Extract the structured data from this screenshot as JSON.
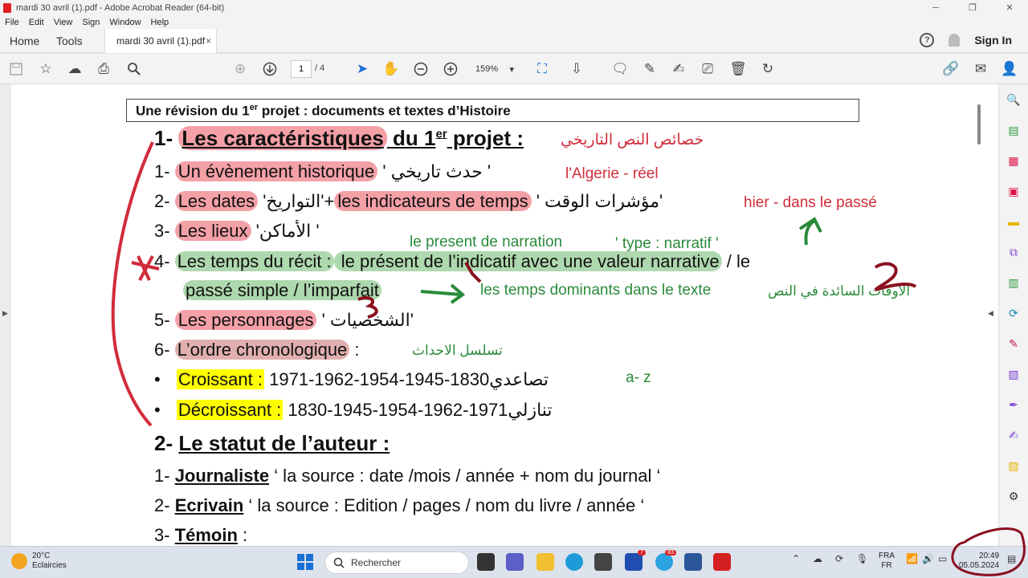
{
  "window": {
    "title": "mardi 30 avril (1).pdf - Adobe Acrobat Reader (64-bit)"
  },
  "menu": [
    "File",
    "Edit",
    "View",
    "Sign",
    "Window",
    "Help"
  ],
  "tabs": {
    "home": "Home",
    "tools": "Tools",
    "doc": "mardi 30 avril (1).pdf",
    "close": "×",
    "signin": "Sign In",
    "help": "?"
  },
  "toolbar": {
    "page_current": "1",
    "page_total": "/ 4",
    "zoom": "159%",
    "zoom_arrow": "▾"
  },
  "doc": {
    "title": "Une révision du 1",
    "title_sup": "er",
    "title_rest": " projet : documents et textes d’Histoire",
    "s1_num": "1-",
    "s1_hl": "Les caractéristiques",
    "s1_mid": " du 1",
    "s1_sup": "er",
    "s1_end": " projet :",
    "l1_num": "1-",
    "l1_hl": "Un évènement historique",
    "l1_rest": " ' حدث تاريخي '",
    "l2_num": "2-",
    "l2_hl": "Les dates",
    "l2_mid": "  'التواريخ'+",
    "l2_hl2": "les indicateurs de temps",
    "l2_rest": " ' مؤشرات الوقت'",
    "l3_num": "3-",
    "l3_hl": "Les lieux",
    "l3_rest": " 'الأماكن '",
    "l4_num": "4-",
    "l4_hl": "Les temps du récit :",
    "l4_hg": " le présent de l’indicatif avec une valeur narrative",
    "l4_rest": " / le",
    "l4b_hg": "passé simple / l’imparfait",
    "l5_num": "5-",
    "l5_hl": "Les personnages",
    "l5_rest": "  ' الشخصيات'",
    "l6_num": "6-",
    "l6_hd": "L’ordre chronologique",
    "l6_rest": " :",
    "b1_bullet": "•",
    "b1_hy": "Croissant :",
    "b1_rest": " تصاعدي1830-1945-1954-1962-1971",
    "b2_bullet": "•",
    "b2_hy": "Décroissant :",
    "b2_rest": " تنازلي1971-1962-1954-1945-1830",
    "s2_num": "2-",
    "s2_title": "Le statut de l’auteur :",
    "a1_num": "1-",
    "a1_label": "Journaliste",
    "a1_rest": " ‘ la source : date /mois / année + nom du journal ‘",
    "a2_num": "2-",
    "a2_label": "Ecrivain",
    "a2_rest": " ‘ la source : Edition / pages / nom du livre / année ‘",
    "a3_num": "3-",
    "a3_label": "Témoin",
    "a3_rest": " :"
  },
  "annotations": {
    "a_char_ar": "خصائص النص التاريخي",
    "a_algerie": "l'Algerie - réel",
    "a_hier": "hier - dans le passé",
    "a_present": "le present de narration",
    "a_type": "' type : narratif '",
    "a_temps_dom": "les temps dominants dans le texte",
    "a_temps_ar": "الاوقات السائدة في النص",
    "a_ordre_ar": "تسلسل الاحداث",
    "a_az": "a- z"
  },
  "colors": {
    "highlight_red": "#ef7882",
    "highlight_green": "#78be78",
    "highlight_yellow": "#ffff00",
    "ink_red": "#d12c3a",
    "ink_green": "#2a8a3a",
    "ink_maroon": "#8a1020"
  },
  "taskbar": {
    "temp": "20°C",
    "weather": "Eclaircies",
    "search": "Rechercher",
    "lang1": "FRA",
    "lang2": "FR",
    "time": "20:49",
    "date": "05.05.2024",
    "badge1": "7",
    "badge2": "83"
  }
}
